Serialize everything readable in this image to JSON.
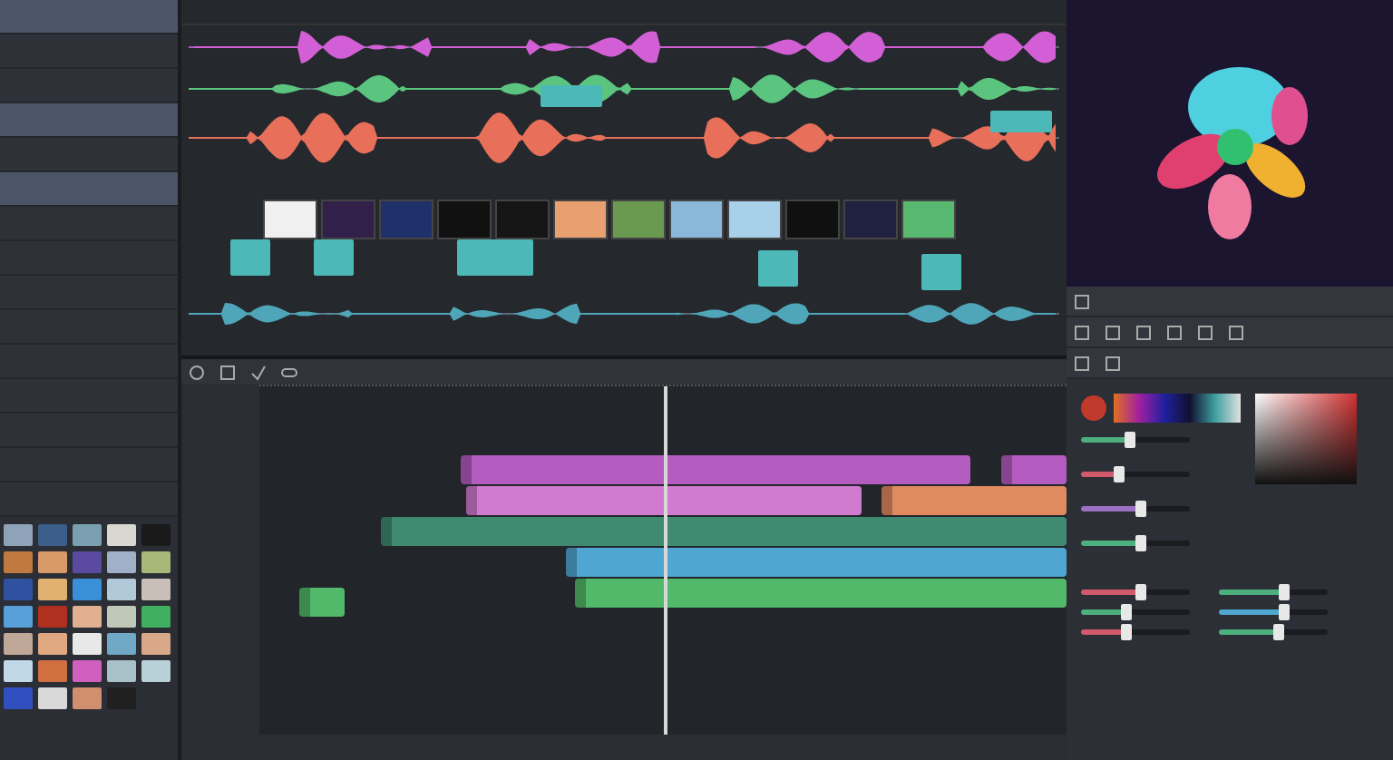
{
  "sidebar": {
    "items": [
      {
        "selected": true
      },
      {
        "selected": false
      },
      {
        "selected": false
      },
      {
        "selected": true
      },
      {
        "selected": false
      },
      {
        "selected": true
      },
      {
        "selected": false
      },
      {
        "selected": false
      },
      {
        "selected": false
      },
      {
        "selected": false
      },
      {
        "selected": false
      },
      {
        "selected": false
      },
      {
        "selected": false
      },
      {
        "selected": false
      },
      {
        "selected": false
      }
    ]
  },
  "media_grid": {
    "thumbnails": [
      {
        "color": "#8fa3b8"
      },
      {
        "color": "#3b5f8a"
      },
      {
        "color": "#7aa0b0"
      },
      {
        "color": "#d8d8d0"
      },
      {
        "color": "#1a1a1a"
      },
      {
        "color": "#c07a40"
      },
      {
        "color": "#d99a6a"
      },
      {
        "color": "#5a4aa0"
      },
      {
        "color": "#a0b0c8"
      },
      {
        "color": "#a8b878"
      },
      {
        "color": "#3050a0"
      },
      {
        "color": "#e0b070"
      },
      {
        "color": "#3a90d8"
      },
      {
        "color": "#b0c8d8"
      },
      {
        "color": "#c8c0b8"
      },
      {
        "color": "#5aa0d8"
      },
      {
        "color": "#b03020"
      },
      {
        "color": "#e0b090"
      },
      {
        "color": "#c0c8b8"
      },
      {
        "color": "#40b060"
      },
      {
        "color": "#c0a898"
      },
      {
        "color": "#e0a880"
      },
      {
        "color": "#e8e8e8"
      },
      {
        "color": "#70a8c8"
      },
      {
        "color": "#d8a888"
      },
      {
        "color": "#c0d8e8"
      },
      {
        "color": "#d07040"
      },
      {
        "color": "#d060c0"
      },
      {
        "color": "#a8c0c8"
      },
      {
        "color": "#b8d0d8"
      },
      {
        "color": "#3050c0"
      },
      {
        "color": "#d8d8d8"
      },
      {
        "color": "#d09070"
      },
      {
        "color": "#202020"
      }
    ]
  },
  "audio_tracks": [
    {
      "color": "#d35fd6"
    },
    {
      "color": "#5bc47f"
    },
    {
      "color": "#e8705a"
    },
    {
      "color": "#4fa6b8"
    }
  ],
  "clip_strip": [
    {
      "color": "#f0f0f0"
    },
    {
      "color": "#30204a"
    },
    {
      "color": "#20306a"
    },
    {
      "color": "#111111"
    },
    {
      "color": "#151515"
    },
    {
      "color": "#e8a070"
    },
    {
      "color": "#6a9a50"
    },
    {
      "color": "#8ab8d8"
    },
    {
      "color": "#a8d0e8"
    },
    {
      "color": "#101010"
    },
    {
      "color": "#202040"
    },
    {
      "color": "#58b870"
    }
  ],
  "timeline": {
    "clips": [
      {
        "color": "#b45cc0"
      },
      {
        "color": "#b45cc0"
      },
      {
        "color": "#d07ad0"
      },
      {
        "color": "#e08a60"
      },
      {
        "color": "#3f8a70"
      },
      {
        "color": "#4fa6d0"
      },
      {
        "color": "#52b86a"
      },
      {
        "color": "#52b86a"
      }
    ]
  },
  "color_panel": {
    "sliders": [
      {
        "color": "#4caf7d",
        "level": 0.45
      },
      {
        "color": "#d05a6a",
        "level": 0.35
      },
      {
        "color": "#9a70c0",
        "level": 0.55
      },
      {
        "color": "#4caf7d",
        "level": 0.55
      }
    ]
  },
  "adjust_panel": {
    "sliders": [
      {
        "color": "#d05a6a",
        "level": 0.55
      },
      {
        "color": "#4caf7d",
        "level": 0.42
      },
      {
        "color": "#d05a6a",
        "level": 0.42
      }
    ]
  },
  "levels_panel": {
    "sliders": [
      {
        "color": "#4caf7d",
        "level": 0.6
      },
      {
        "color": "#4fa6d0",
        "level": 0.6
      },
      {
        "color": "#4caf7d",
        "level": 0.55
      }
    ]
  }
}
